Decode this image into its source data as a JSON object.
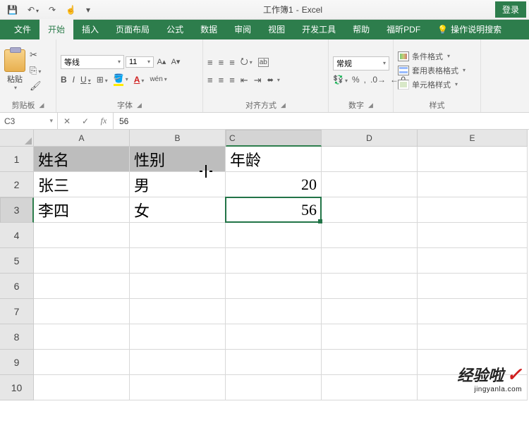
{
  "qat": {
    "icons": [
      "save-icon",
      "undo-icon",
      "redo-icon",
      "preview-icon",
      "customize-icon"
    ],
    "title_doc": "工作簿1",
    "title_sep": "-",
    "title_app": "Excel",
    "login": "登录"
  },
  "tabs": {
    "file": "文件",
    "home": "开始",
    "insert": "插入",
    "page_layout": "页面布局",
    "formulas": "公式",
    "data": "数据",
    "review": "审阅",
    "view": "视图",
    "developer": "开发工具",
    "help": "帮助",
    "foxit": "福昕PDF",
    "tell_me": "操作说明搜索"
  },
  "ribbon": {
    "clipboard": {
      "paste": "粘贴",
      "label": "剪贴板"
    },
    "font": {
      "name": "等线",
      "size": "11",
      "bold": "B",
      "italic": "I",
      "underline": "U",
      "label": "字体",
      "wen": "wén"
    },
    "alignment": {
      "wrap": "ab",
      "label": "对齐方式"
    },
    "number": {
      "format": "常规",
      "percent": "%",
      "comma": ",",
      "label": "数字"
    },
    "styles": {
      "conditional": "条件格式",
      "table": "套用表格格式",
      "cell": "单元格样式",
      "label": "样式"
    }
  },
  "formula_bar": {
    "name_box": "C3",
    "formula": "56"
  },
  "grid": {
    "columns": [
      "A",
      "B",
      "C",
      "D",
      "E"
    ],
    "rows": [
      "1",
      "2",
      "3",
      "4",
      "5",
      "6",
      "7",
      "8",
      "9",
      "10"
    ],
    "active_col": "C",
    "active_row": "3",
    "data": {
      "A1": "姓名",
      "B1": "性别",
      "C1": "年龄",
      "A2": "张三",
      "B2": "男",
      "C2": "20",
      "A3": "李四",
      "B3": "女",
      "C3": "56"
    },
    "headers_selected": [
      "A1",
      "B1"
    ]
  },
  "watermark": {
    "text": "经验啦",
    "url": "jingyanla.com"
  }
}
